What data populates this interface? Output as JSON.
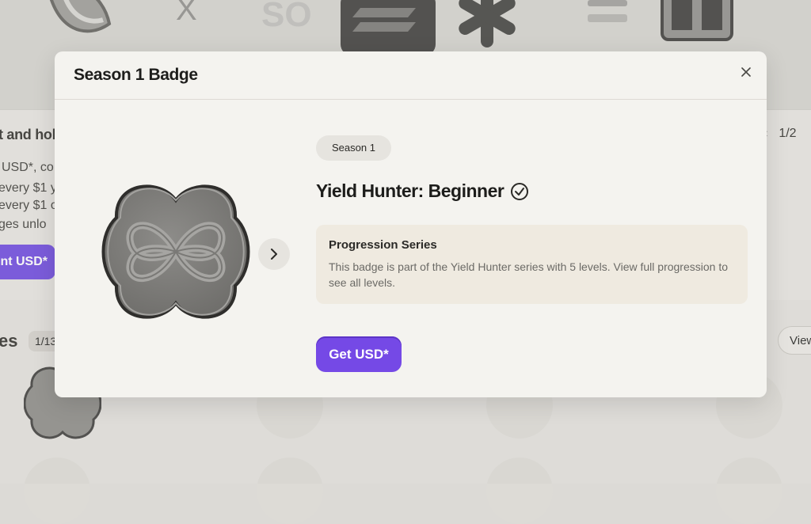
{
  "background": {
    "heading_fragment": "t and hol",
    "lines": [
      "USD*, co",
      "every $1 y",
      "every $1 o",
      "ges unlo"
    ],
    "cta_fragment": "nt USD*",
    "pager_text": "1/2",
    "section_fragment": "es",
    "section_count": "1/13",
    "view_fragment": "View",
    "logo_text": "SO"
  },
  "modal": {
    "title": "Season 1 Badge",
    "season_pill": "Season 1",
    "badge_name": "Yield Hunter: Beginner",
    "info_title": "Progression Series",
    "info_body": "This badge is part of the Yield Hunter series with 5 levels. View full progression to see all levels.",
    "primary_button": "Get USD*"
  },
  "colors": {
    "accent": "#7549e6",
    "modal_bg": "#f4f3ef",
    "info_bg": "#efeae0"
  },
  "icons": {
    "close": "close-icon",
    "next": "chevron-right-icon",
    "verified": "check-circle-icon",
    "pager_prev": "chevron-left-icon"
  }
}
